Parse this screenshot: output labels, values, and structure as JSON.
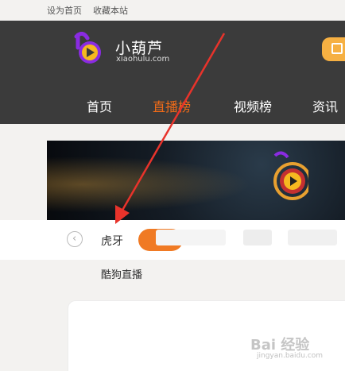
{
  "topbar": {
    "set_homepage": "设为首页",
    "bookmark": "收藏本站"
  },
  "logo": {
    "name": "小葫芦",
    "domain": "xiaohulu.com",
    "icon": "play-gourd-logo",
    "brand_color": "#8a2be2"
  },
  "nav": {
    "items": [
      {
        "label": "首页"
      },
      {
        "label": "直播榜",
        "active": true
      },
      {
        "label": "视频榜"
      },
      {
        "label": "资讯"
      }
    ],
    "active_color": "#f06b18"
  },
  "platforms": {
    "prev_icon": "chevron-left-icon",
    "tabs": [
      {
        "label": "虎牙"
      }
    ],
    "sub_items": [
      {
        "label": "酷狗直播"
      }
    ],
    "pill_color": "#f07a24"
  },
  "watermark": {
    "text": "Bai 经验",
    "sub": "jingyan.baidu.com"
  },
  "annotation": {
    "arrow_color": "#e8332b"
  }
}
